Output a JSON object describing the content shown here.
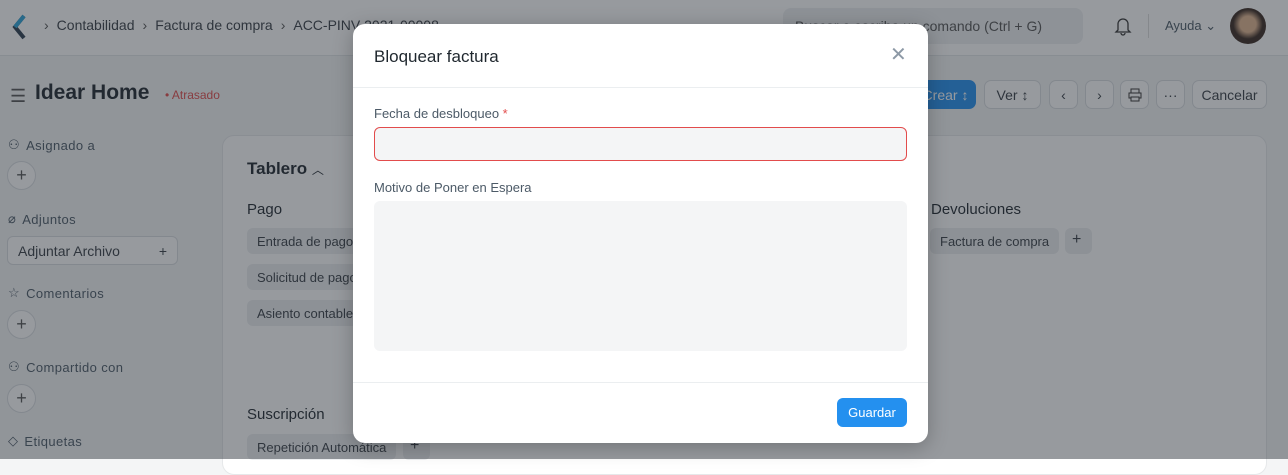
{
  "navbar": {
    "breadcrumbs": [
      "Contabilidad",
      "Factura de compra",
      "ACC-PINV-2021-00008"
    ],
    "search_placeholder": "Buscar o escriba un comando (Ctrl + G)",
    "help_label": "Ayuda"
  },
  "page": {
    "title": "Idear Home",
    "status": "Atrasado",
    "status_color": "#e24c4c"
  },
  "toolbar": {
    "create_label": "Crear",
    "view_label": "Ver",
    "print_icon": "printer-icon",
    "more_label": "···",
    "cancel_label": "Cancelar"
  },
  "sidebar": {
    "assigned": "Asignado a",
    "attachments": "Adjuntos",
    "attach_file": "Adjuntar Archivo",
    "comments": "Comentarios",
    "shared": "Compartido con",
    "tags": "Etiquetas"
  },
  "dashboard": {
    "title": "Tablero",
    "payment": {
      "title": "Pago",
      "items": [
        "Entrada de pago",
        "Solicitud de pago",
        "Asiento contable"
      ]
    },
    "returns": {
      "title": "Devoluciones",
      "items": [
        "Factura de compra"
      ]
    },
    "subscription": {
      "title": "Suscripción",
      "items": [
        "Repetición Automática"
      ]
    }
  },
  "modal": {
    "title": "Bloquear factura",
    "field1_label": "Fecha de desbloqueo",
    "required_mark": "*",
    "field1_value": "",
    "field2_label": "Motivo de Poner en Espera",
    "field2_value": "",
    "save_label": "Guardar",
    "accent": "#2490ef"
  }
}
